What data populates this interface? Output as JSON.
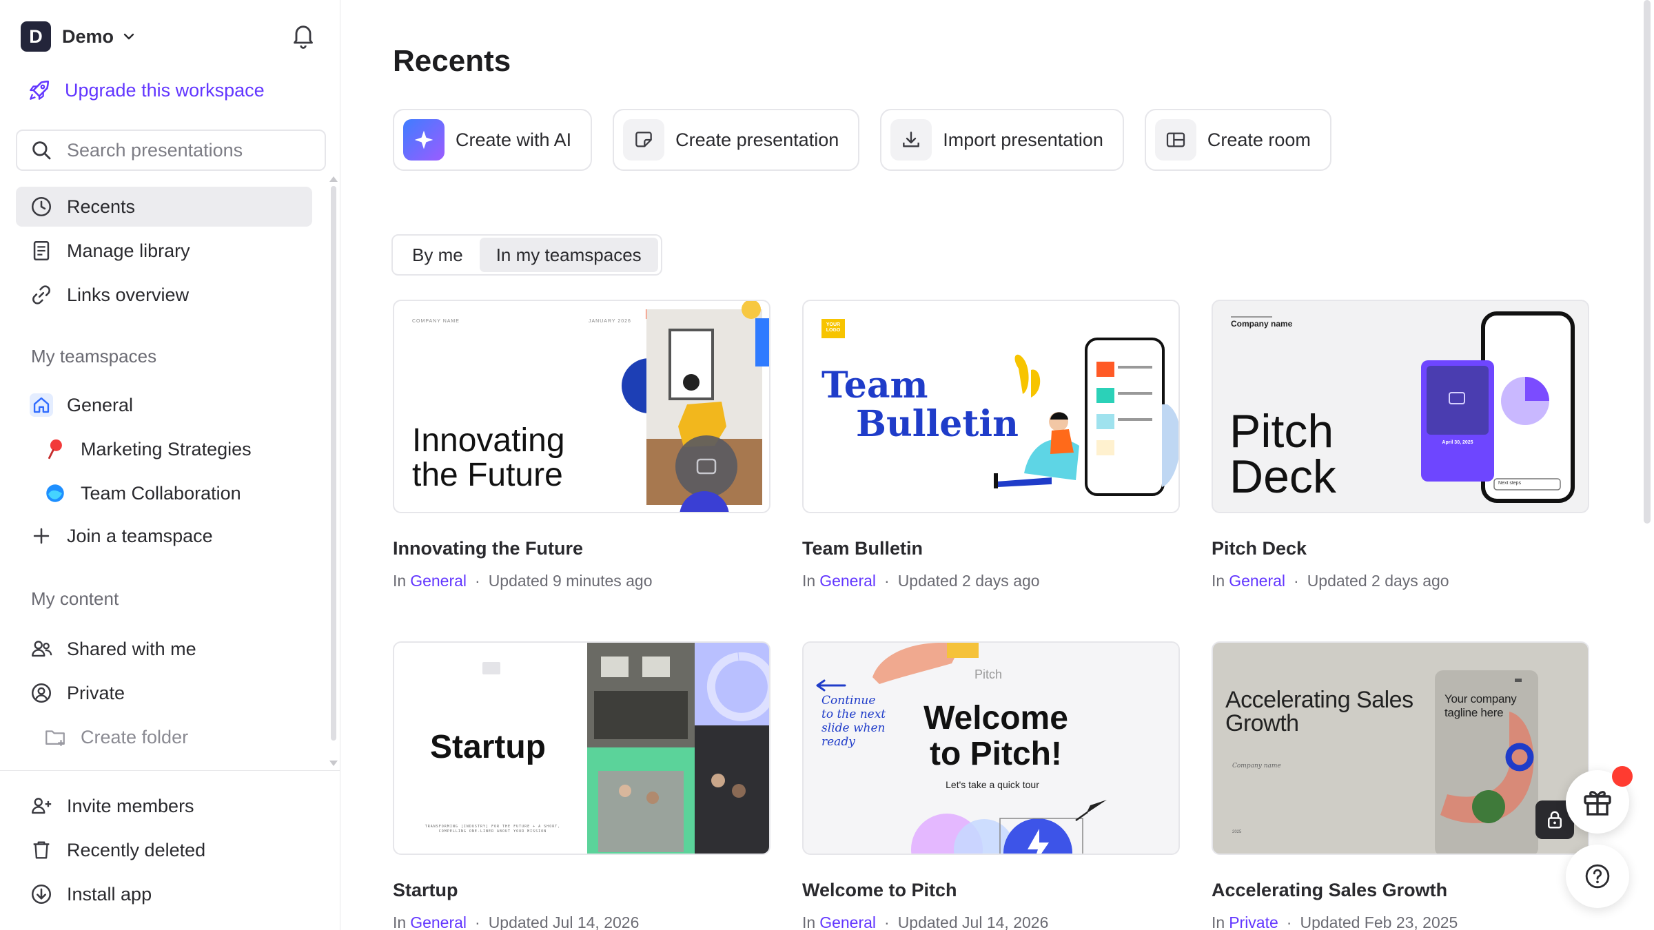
{
  "workspace": {
    "initial": "D",
    "name": "Demo"
  },
  "sidebar": {
    "upgrade_label": "Upgrade this workspace",
    "search_placeholder": "Search presentations",
    "nav": [
      {
        "label": "Recents",
        "icon": "clock-icon",
        "active": true
      },
      {
        "label": "Manage library",
        "icon": "library-icon"
      },
      {
        "label": "Links overview",
        "icon": "link-icon"
      }
    ],
    "teamspaces_heading": "My teamspaces",
    "teamspaces": [
      {
        "label": "General",
        "icon": "home-icon"
      },
      {
        "label": "Marketing Strategies",
        "icon": "pin-icon"
      },
      {
        "label": "Team Collaboration",
        "icon": "wave-icon"
      }
    ],
    "join_label": "Join a teamspace",
    "content_heading": "My content",
    "content": [
      {
        "label": "Shared with me",
        "icon": "people-icon"
      },
      {
        "label": "Private",
        "icon": "user-circle-icon"
      }
    ],
    "create_folder_label": "Create folder",
    "footer": [
      {
        "label": "Invite members",
        "icon": "invite-icon"
      },
      {
        "label": "Recently deleted",
        "icon": "trash-icon"
      },
      {
        "label": "Install app",
        "icon": "download-icon"
      }
    ]
  },
  "main": {
    "title": "Recents",
    "actions": [
      {
        "label": "Create with AI",
        "icon": "sparkle-icon"
      },
      {
        "label": "Create presentation",
        "icon": "presentation-icon"
      },
      {
        "label": "Import presentation",
        "icon": "import-icon"
      },
      {
        "label": "Create room",
        "icon": "room-icon"
      }
    ],
    "filter": {
      "by_me": "By me",
      "in_teamspaces": "In my teamspaces",
      "selected": "In my teamspaces"
    },
    "cards": [
      {
        "title": "Innovating the Future",
        "prefix": "In",
        "space": "General",
        "updated": "Updated 9 minutes ago",
        "thumb": {
          "small_left": "COMPANY NAME",
          "small_right": "JANUARY 2026",
          "big": "Innovating the Future"
        }
      },
      {
        "title": "Team Bulletin",
        "prefix": "In",
        "space": "General",
        "updated": "Updated 2 days ago",
        "thumb": {
          "logo": "YOUR LOGO",
          "big1": "Team",
          "big2": "Bulletin"
        }
      },
      {
        "title": "Pitch Deck",
        "prefix": "In",
        "space": "General",
        "updated": "Updated 2 days ago",
        "thumb": {
          "small": "Company name",
          "big1": "Pitch",
          "big2": "Deck",
          "phone_date": "April 30, 2025",
          "phone_btn": "Next steps"
        }
      },
      {
        "title": "Startup",
        "prefix": "In",
        "space": "General",
        "updated": "Updated Jul 14, 2026",
        "thumb": {
          "big": "Startup",
          "tagline": "TRANSFORMING [INDUSTRY] FOR THE FUTURE + A SHORT, COMPELLING ONE-LINER ABOUT YOUR MISSION"
        }
      },
      {
        "title": "Welcome to Pitch",
        "prefix": "In",
        "space": "General",
        "updated": "Updated Jul 14, 2026",
        "thumb": {
          "brand": "Pitch",
          "side_note": "Continue to the next slide when ready",
          "big1": "Welcome",
          "big2": "to Pitch!",
          "sub": "Let's take a quick tour"
        }
      },
      {
        "title": "Accelerating Sales Growth",
        "prefix": "In",
        "space": "Private",
        "updated": "Updated Feb 23, 2025",
        "thumb": {
          "big": "Accelerating Sales Growth",
          "company": "Company name",
          "year": "2025",
          "tagline": "Your company tagline here"
        }
      }
    ]
  },
  "colors": {
    "accent": "#6236ff",
    "sidebar_active": "#ececef",
    "border": "#e6e6ea"
  }
}
